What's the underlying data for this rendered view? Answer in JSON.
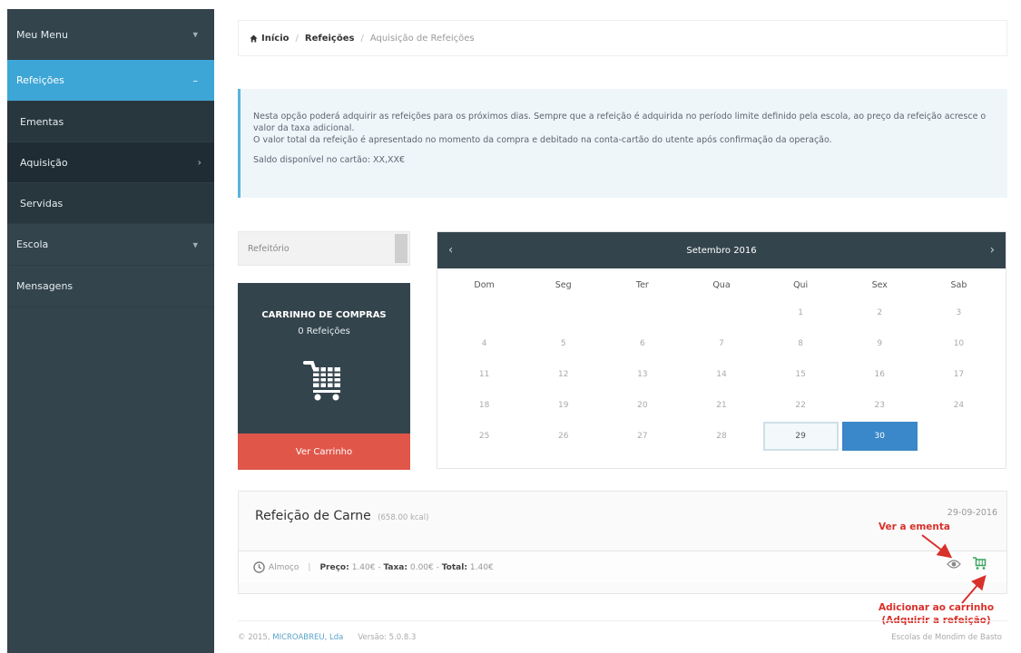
{
  "sidebar": {
    "items": [
      {
        "label": "Meu Menu"
      },
      {
        "label": "Refeições"
      },
      {
        "label": "Ementas"
      },
      {
        "label": "Aquisição"
      },
      {
        "label": "Servidas"
      },
      {
        "label": "Escola"
      },
      {
        "label": "Mensagens"
      }
    ]
  },
  "breadcrumb": {
    "home": "Início",
    "section": "Refeições",
    "current": "Aquisição de Refeições"
  },
  "info": {
    "line1": "Nesta opção poderá adquirir as refeições para os próximos dias. Sempre que a refeição é adquirida no período limite definido pela escola, ao preço da refeição acresce o valor da taxa adicional.",
    "line2": "O valor total da refeição é apresentado no momento da compra e debitado na conta-cartão do utente após confirmação da operação.",
    "balance": "Saldo disponível no cartão: XX,XX€"
  },
  "selector": {
    "value": "Refeitório"
  },
  "cart": {
    "title": "CARRINHO DE COMPRAS",
    "count": "0 Refeições",
    "button": "Ver Carrinho"
  },
  "calendar": {
    "month": "Setembro 2016",
    "days_of_week": [
      "Dom",
      "Seg",
      "Ter",
      "Qua",
      "Qui",
      "Sex",
      "Sab"
    ],
    "weeks": [
      [
        "",
        "",
        "",
        "",
        "1",
        "2",
        "3"
      ],
      [
        "4",
        "5",
        "6",
        "7",
        "8",
        "9",
        "10"
      ],
      [
        "11",
        "12",
        "13",
        "14",
        "15",
        "16",
        "17"
      ],
      [
        "18",
        "19",
        "20",
        "21",
        "22",
        "23",
        "24"
      ],
      [
        "25",
        "26",
        "27",
        "28",
        "29",
        "30",
        ""
      ]
    ],
    "today": "29",
    "selected": "30"
  },
  "meal": {
    "name": "Refeição de Carne",
    "kcal": "(658.00 kcal)",
    "date": "29-09-2016",
    "type": "Almoço",
    "price_label": "Preço:",
    "price": "1.40€",
    "fee_label": "Taxa:",
    "fee": "0.00€",
    "total_label": "Total:",
    "total": "1.40€"
  },
  "annotations": {
    "view_menu": "Ver a ementa",
    "add_cart_1": "Adicionar ao carrinho",
    "add_cart_2": "(Adquirir a refeição)"
  },
  "footer": {
    "copyright": "© 2015,",
    "company": "MICROABREU, Lda",
    "version": "Versão: 5.0.8.3",
    "school": "Escolas de Mondim de Basto"
  },
  "colors": {
    "sidebar": "#34444d",
    "active": "#3ea6d6",
    "cart_button": "#e0574a",
    "selected_day": "#3a87c9",
    "annotation": "#d9302a"
  }
}
